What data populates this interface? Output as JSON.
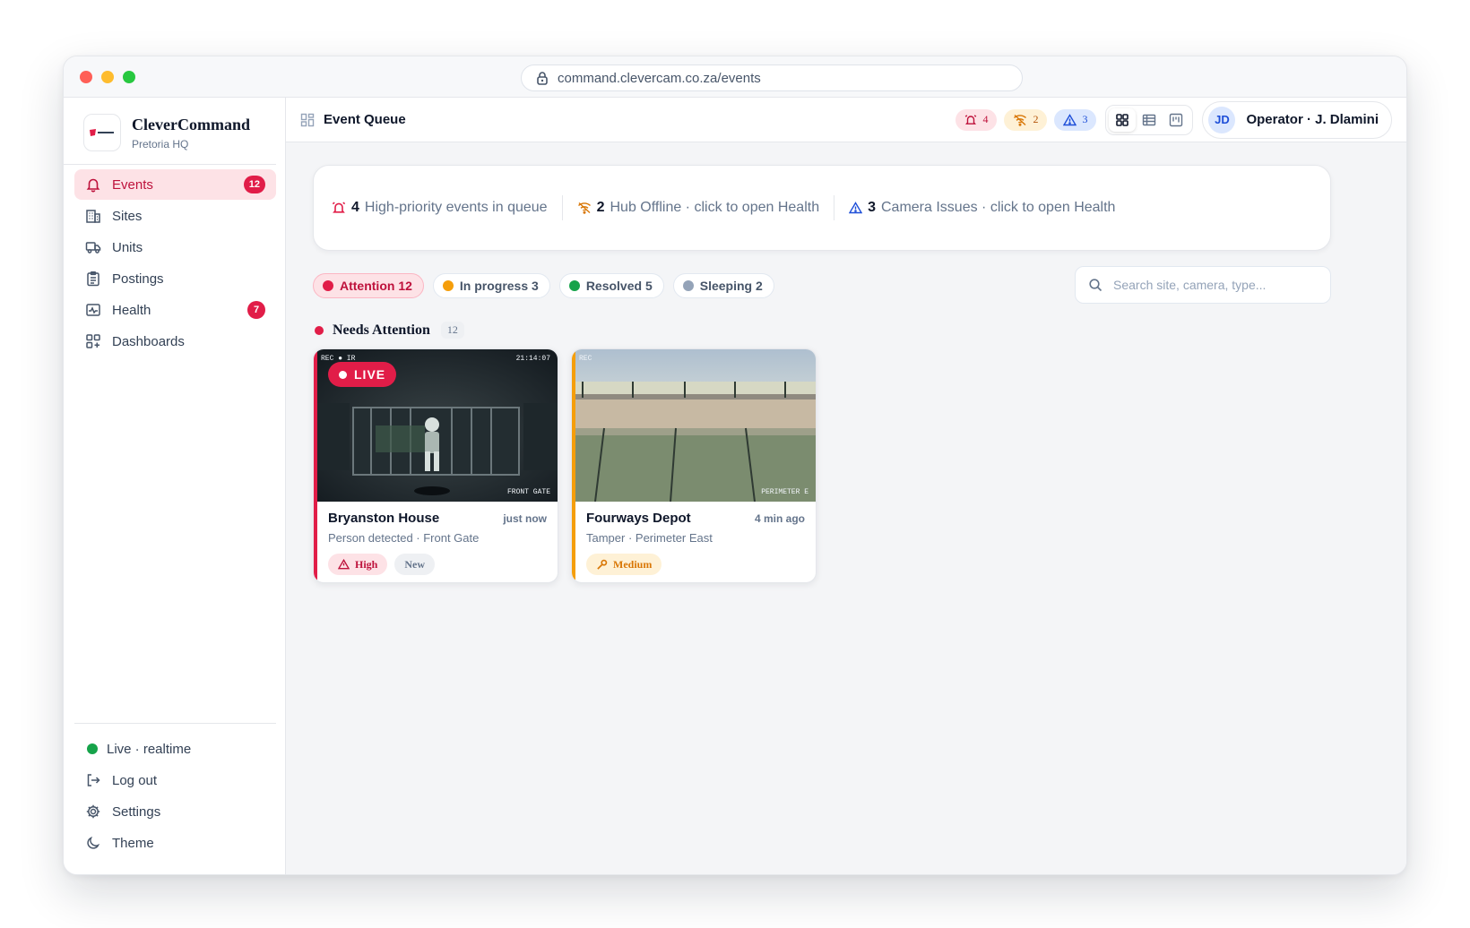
{
  "browser": {
    "url": "command.clevercam.co.za/events"
  },
  "brand": {
    "name": "CleverCommand",
    "location": "Pretoria HQ"
  },
  "nav": {
    "items": [
      {
        "label": "Events",
        "badge": "12"
      },
      {
        "label": "Sites",
        "badge": ""
      },
      {
        "label": "Units",
        "badge": ""
      },
      {
        "label": "Postings",
        "badge": ""
      },
      {
        "label": "Health",
        "badge": "7"
      },
      {
        "label": "Dashboards",
        "badge": ""
      }
    ],
    "bottom": {
      "live": "Live · realtime",
      "logout": "Log out",
      "settings": "Settings",
      "theme": "Theme"
    }
  },
  "header": {
    "title": "Event Queue",
    "alerts": {
      "high": "4",
      "offline": "2",
      "camera": "3"
    },
    "user": {
      "initials": "JD",
      "name": "Operator · J. Dlamini"
    }
  },
  "summary": {
    "high": {
      "count": "4",
      "text": "High-priority events in queue"
    },
    "hub": {
      "count": "2",
      "text": "Hub Offline · click to open Health"
    },
    "camera": {
      "count": "3",
      "text": "Camera Issues · click to open Health"
    }
  },
  "filters": [
    {
      "label": "Attention 12",
      "color": "#e11d48"
    },
    {
      "label": "In progress 3",
      "color": "#f59e0b"
    },
    {
      "label": "Resolved 5",
      "color": "#16a34a"
    },
    {
      "label": "Sleeping 2",
      "color": "#94a3b8"
    }
  ],
  "search": {
    "placeholder": "Search site, camera, type..."
  },
  "section": {
    "title": "Needs Attention",
    "count": "12"
  },
  "cards": [
    {
      "site": "Bryanston House",
      "time": "just now",
      "subtitle": "Person detected · Front Gate",
      "osd_left": "REC ● IR",
      "osd_time": "21:14:07",
      "camera_label": "FRONT GATE",
      "live": "LIVE",
      "priority": "High",
      "status": "New",
      "accent": "#e11d48"
    },
    {
      "site": "Fourways Depot",
      "time": "4 min ago",
      "subtitle": "Tamper · Perimeter East",
      "osd_left": "REC",
      "camera_label": "PERIMETER E",
      "priority": "Medium",
      "accent": "#f59e0b"
    }
  ]
}
